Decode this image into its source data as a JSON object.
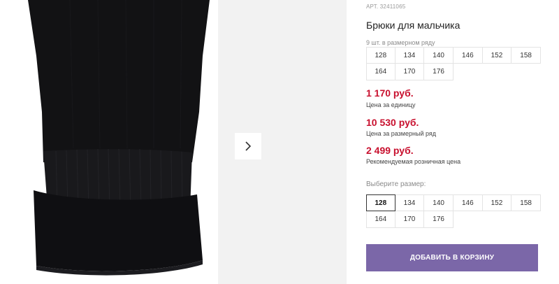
{
  "product": {
    "article_label": "АРТ.",
    "article_number": "32411065",
    "title": "Брюки для мальчика",
    "pack_note": "9 шт. в размерном ряду"
  },
  "pack_sizes": [
    "128",
    "134",
    "140",
    "146",
    "152",
    "158",
    "164",
    "170",
    "176"
  ],
  "prices": {
    "unit_price": "1 170 руб.",
    "unit_label": "Цена за единицу",
    "row_price": "10 530 руб.",
    "row_label": "Цена за размерный ряд",
    "retail_price": "2 499 руб.",
    "retail_label": "Рекомендуемая розничная цена"
  },
  "size_selector": {
    "label": "Выберите размер:",
    "options": [
      "128",
      "134",
      "140",
      "146",
      "152",
      "158",
      "164",
      "170",
      "176"
    ],
    "selected": "128"
  },
  "cart_button": {
    "label": "ДОБАВИТЬ В КОРЗИНУ"
  },
  "colors": {
    "price": "#c8102e",
    "button": "#7b67a8"
  },
  "icons": {
    "next": "chevron-right-icon"
  }
}
